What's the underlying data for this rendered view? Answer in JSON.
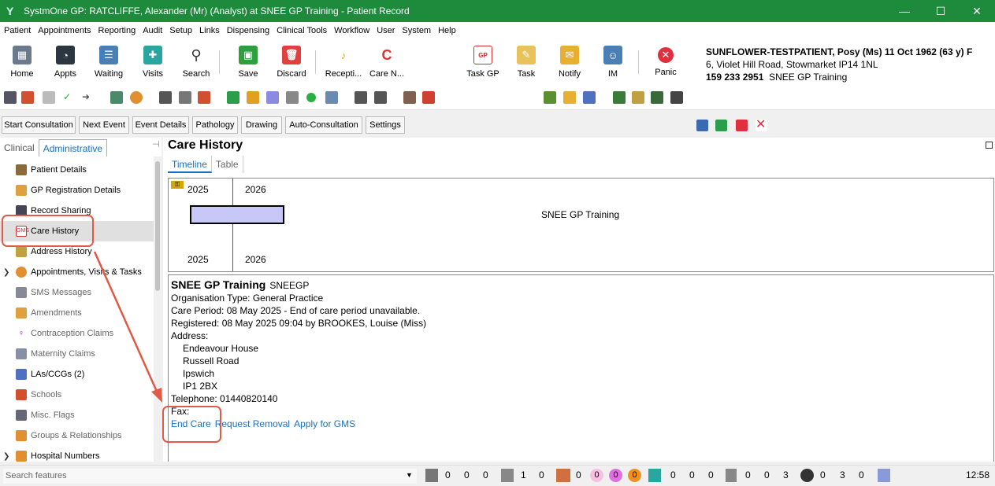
{
  "window": {
    "title": "SystmOne GP: RATCLIFFE, Alexander (Mr) (Analyst) at SNEE GP Training - Patient Record",
    "controls": [
      "—",
      "☐",
      "✕"
    ]
  },
  "menu": [
    "Patient",
    "Appointments",
    "Reporting",
    "Audit",
    "Setup",
    "Links",
    "Dispensing",
    "Clinical Tools",
    "Workflow",
    "User",
    "System",
    "Help"
  ],
  "toolbar": {
    "home": "Home",
    "appts": "Appts",
    "waiting": "Waiting",
    "visits": "Visits",
    "search": "Search",
    "save": "Save",
    "discard": "Discard",
    "reception": "Recepti...",
    "care_n": "Care N...",
    "task_gp": "Task GP",
    "task": "Task",
    "notify": "Notify",
    "im": "IM",
    "panic": "Panic"
  },
  "patient": {
    "name": "SUNFLOWER-TESTPATIENT, Posy (Ms) 11 Oct 1962 (63 y) F",
    "address": "6, Violet Hill Road, Stowmarket IP14 1NL",
    "nhs": "159 233 2951",
    "practice": "SNEE GP Training"
  },
  "tabs": [
    "Start Consultation",
    "Next Event",
    "Event Details",
    "Pathology",
    "Drawing",
    "Auto-Consultation",
    "Settings"
  ],
  "left_tabs": {
    "clinical": "Clinical",
    "administrative": "Administrative"
  },
  "sidebar": [
    "Patient Details",
    "GP Registration Details",
    "Record Sharing",
    "Care History",
    "Address History",
    "Appointments, Visits & Tasks",
    "SMS Messages",
    "Amendments",
    "Contraception Claims",
    "Maternity Claims",
    "LAs/CCGs (2)",
    "Schools",
    "Misc. Flags",
    "Groups & Relationships",
    "Hospital Numbers"
  ],
  "main": {
    "title": "Care History",
    "subtab_timeline": "Timeline",
    "subtab_table": "Table"
  },
  "timeline": {
    "year1": "2025",
    "year2": "2026",
    "bar_label": "SNEE GP Training"
  },
  "detail": {
    "org": "SNEE GP Training",
    "code": "SNEEGP",
    "org_type": "Organisation Type: General Practice",
    "care_period": "Care Period: 08 May 2025 -  End of care period unavailable.",
    "registered": "Registered: 08 May 2025 09:04 by BROOKES, Louise (Miss)",
    "address_label": "Address:",
    "addr1": "Endeavour House",
    "addr2": "Russell Road",
    "addr3": "Ipswich",
    "addr4": "IP1 2BX",
    "telephone": "Telephone: 01440820140",
    "fax": "Fax:",
    "end_care": "End Care",
    "request_removal": "Request Removal",
    "apply_gms": "Apply for GMS"
  },
  "status": {
    "search_placeholder": "Search features",
    "c1": "0",
    "c2": "0",
    "c3": "0",
    "c4": "1",
    "c5": "0",
    "c6": "0",
    "c7": "0",
    "c8": "0",
    "c9": "0",
    "c10": "0",
    "c11": "0",
    "c12": "0",
    "c13": "0",
    "c14": "0",
    "c15": "3",
    "c16": "0",
    "c17": "3",
    "c18": "0",
    "time": "12:58"
  }
}
